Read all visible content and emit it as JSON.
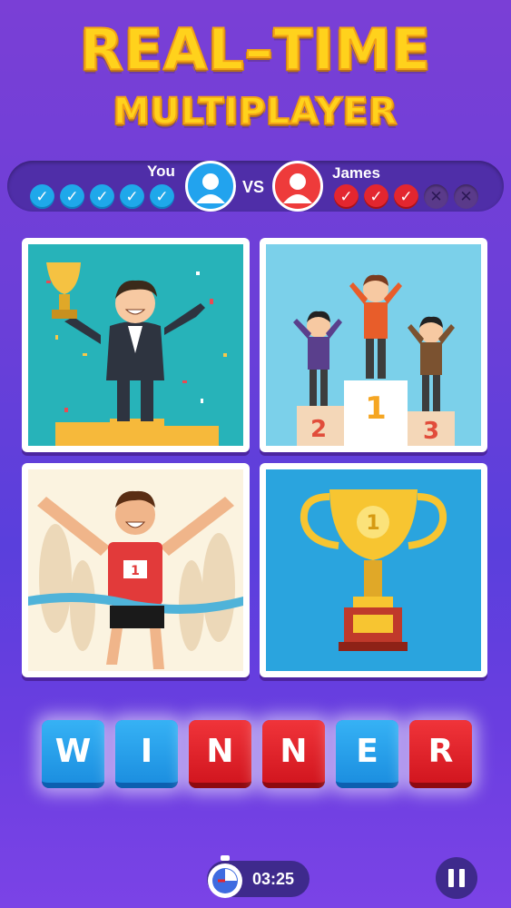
{
  "title": {
    "line1": "REAL–TIME",
    "line2": "MULTIPLAYER"
  },
  "players": {
    "you": {
      "name": "You",
      "results": [
        "check",
        "check",
        "check",
        "check",
        "check"
      ]
    },
    "vs_label": "VS",
    "opponent": {
      "name": "James",
      "results": [
        "check",
        "check",
        "check",
        "cross",
        "cross"
      ]
    }
  },
  "puzzle_images": [
    {
      "name": "trophy-winner-podium"
    },
    {
      "name": "podium-1-2-3"
    },
    {
      "name": "runner-finish-line"
    },
    {
      "name": "gold-trophy-1"
    }
  ],
  "answer": {
    "letters": [
      {
        "char": "W",
        "color": "blue"
      },
      {
        "char": "I",
        "color": "blue"
      },
      {
        "char": "N",
        "color": "red"
      },
      {
        "char": "N",
        "color": "red"
      },
      {
        "char": "E",
        "color": "blue"
      },
      {
        "char": "R",
        "color": "red"
      }
    ]
  },
  "timer": {
    "value": "03:25",
    "icon": "stopwatch-icon"
  },
  "pause": {
    "icon": "pause-icon"
  },
  "colors": {
    "accent_yellow": "#ffd21c",
    "blue": "#1fa8ea",
    "red": "#e3262f"
  }
}
